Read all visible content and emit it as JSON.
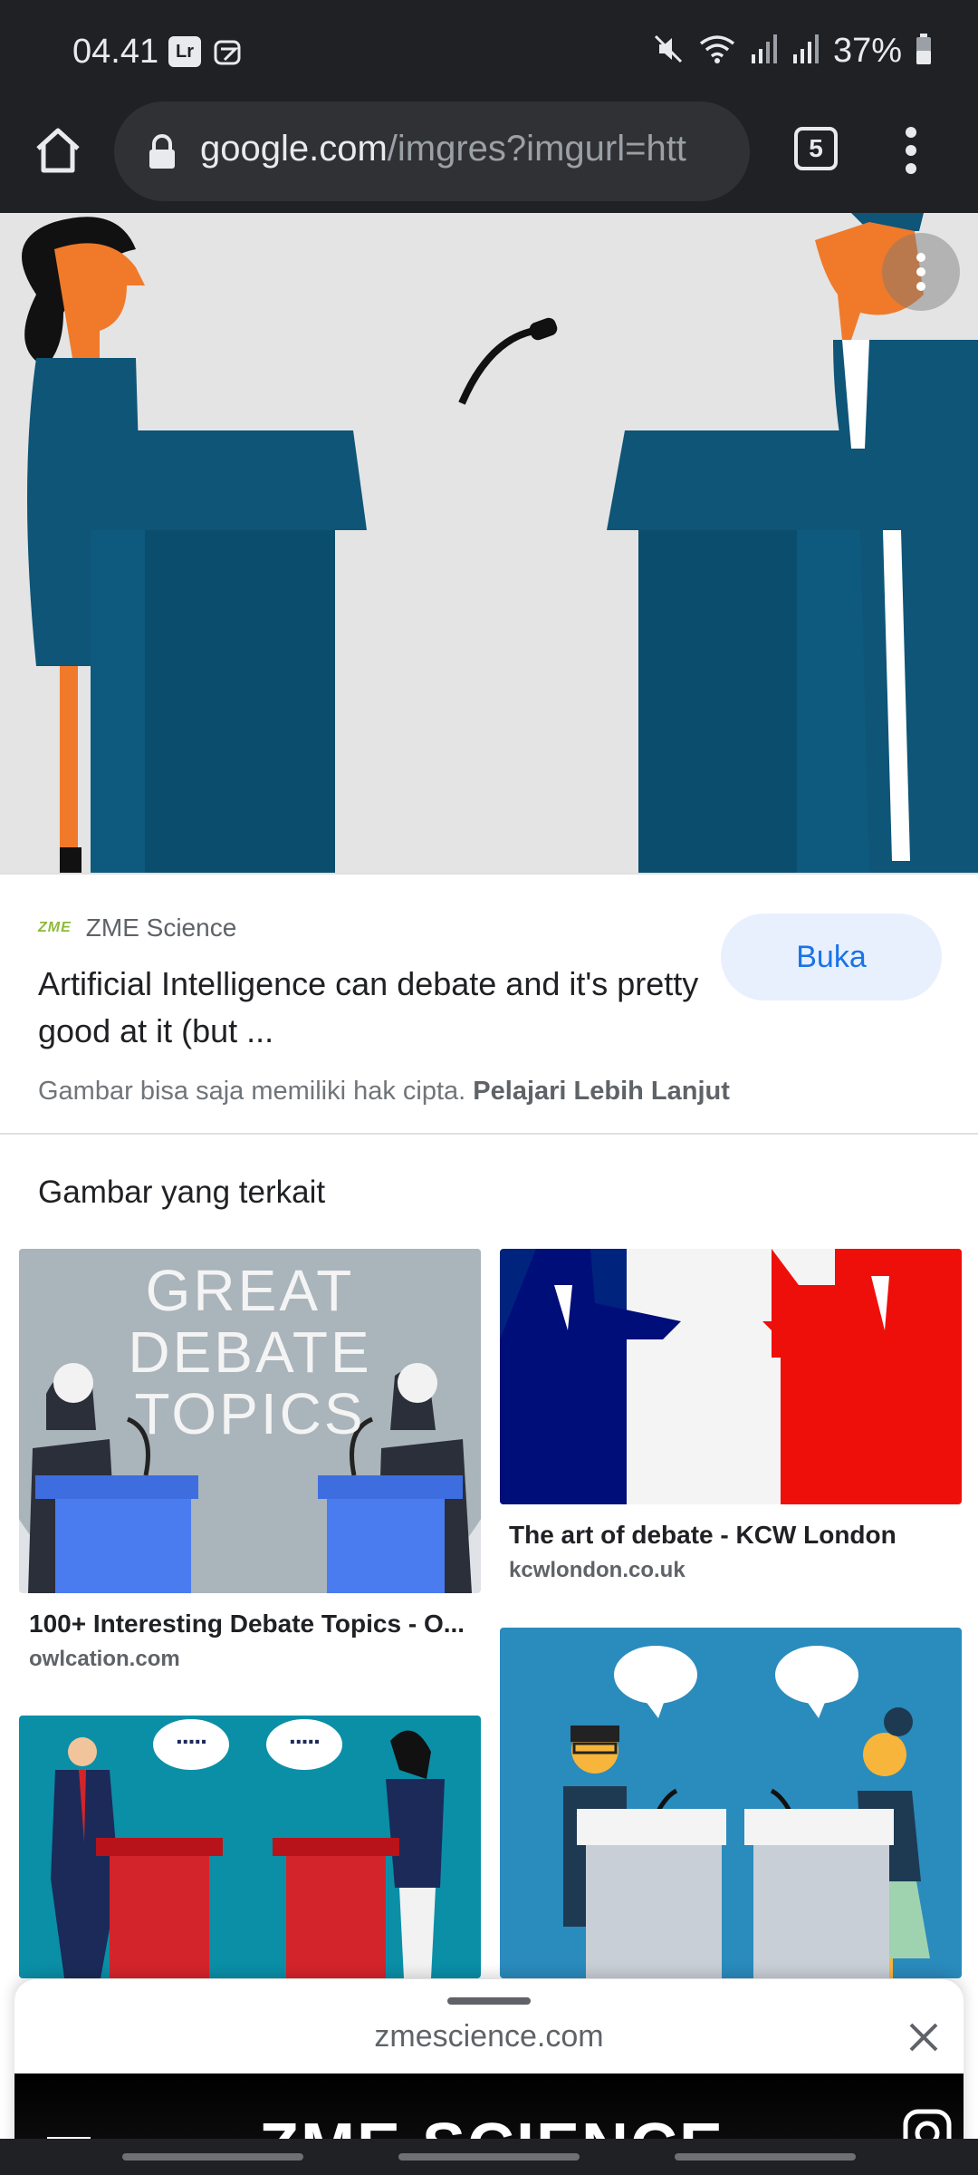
{
  "status_bar": {
    "time": "04.41",
    "app_icon_1": "Lr",
    "battery_percent": "37%",
    "icons": [
      "mute-icon",
      "wifi-icon",
      "signal-icon",
      "signal-icon",
      "battery-icon"
    ]
  },
  "browser": {
    "url_host": "google.com",
    "url_path": "/imgres?imgurl=htt",
    "tab_count": "5"
  },
  "result": {
    "source_name": "ZME Science",
    "source_logo_text": "ZME",
    "title": "Artificial Intelligence can debate and it's pretty good at it (but ...",
    "open_label": "Buka",
    "copyright_text": "Gambar bisa saja memiliki hak cipta.",
    "learn_more": "Pelajari Lebih Lanjut"
  },
  "related": {
    "heading": "Gambar yang terkait",
    "items": [
      {
        "caption": "100+ Interesting Debate Topics - O...",
        "domain": "owlcation.com",
        "image_text": [
          "GREAT",
          "DEBATE",
          "TOPICS"
        ]
      },
      {
        "caption": "The art of debate - KCW London",
        "domain": "kcwlondon.co.uk"
      },
      {
        "speech": "....."
      },
      {
        "speech": ""
      }
    ]
  },
  "sheet": {
    "domain": "zmescience.com",
    "brand": "ZME SCIENCE"
  },
  "colors": {
    "podium": "#0e5577",
    "skin": "#f07a2a",
    "open_bg": "#e8f0fe",
    "open_fg": "#1a73e8"
  }
}
